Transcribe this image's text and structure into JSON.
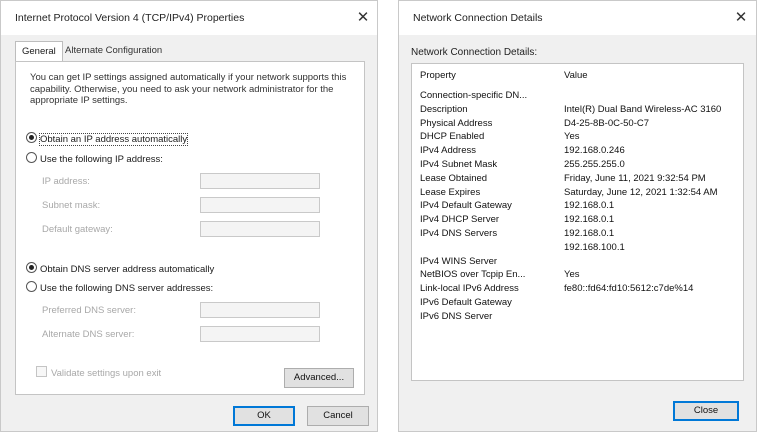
{
  "ipv4_dialog": {
    "title": "Internet Protocol Version 4 (TCP/IPv4) Properties",
    "close_glyph": "✕",
    "tabs": [
      {
        "label": "General",
        "active": true
      },
      {
        "label": "Alternate Configuration",
        "active": false
      }
    ],
    "description": "You can get IP settings assigned automatically if your network supports this capability. Otherwise, you need to ask your network administrator for the appropriate IP settings.",
    "ip_auto_label": "Obtain an IP address automatically",
    "ip_manual_label": "Use the following IP address:",
    "ip_address_label": "IP address:",
    "subnet_mask_label": "Subnet mask:",
    "default_gateway_label": "Default gateway:",
    "dns_auto_label": "Obtain DNS server address automatically",
    "dns_manual_label": "Use the following DNS server addresses:",
    "preferred_dns_label": "Preferred DNS server:",
    "alternate_dns_label": "Alternate DNS server:",
    "validate_label": "Validate settings upon exit",
    "advanced_button": "Advanced...",
    "ok_button": "OK",
    "cancel_button": "Cancel"
  },
  "details_dialog": {
    "title": "Network Connection Details",
    "close_glyph": "✕",
    "group_title": "Network Connection Details:",
    "col_property": "Property",
    "col_value": "Value",
    "rows": [
      {
        "property": "Connection-specific DN...",
        "value": ""
      },
      {
        "property": "Description",
        "value": "Intel(R) Dual Band Wireless-AC 3160"
      },
      {
        "property": "Physical Address",
        "value": "D4-25-8B-0C-50-C7"
      },
      {
        "property": "DHCP Enabled",
        "value": "Yes"
      },
      {
        "property": "IPv4 Address",
        "value": "192.168.0.246"
      },
      {
        "property": "IPv4 Subnet Mask",
        "value": "255.255.255.0"
      },
      {
        "property": "Lease Obtained",
        "value": "Friday, June 11, 2021 9:32:54 PM"
      },
      {
        "property": "Lease Expires",
        "value": "Saturday, June 12, 2021 1:32:54 AM"
      },
      {
        "property": "IPv4 Default Gateway",
        "value": "192.168.0.1"
      },
      {
        "property": "IPv4 DHCP Server",
        "value": "192.168.0.1"
      },
      {
        "property": "IPv4 DNS Servers",
        "value": "192.168.0.1"
      },
      {
        "property": "",
        "value": "192.168.100.1"
      },
      {
        "property": "IPv4 WINS Server",
        "value": ""
      },
      {
        "property": "NetBIOS over Tcpip En...",
        "value": "Yes"
      },
      {
        "property": "Link-local IPv6 Address",
        "value": "fe80::fd64:fd10:5612:c7de%14"
      },
      {
        "property": "IPv6 Default Gateway",
        "value": ""
      },
      {
        "property": "IPv6 DNS Server",
        "value": ""
      }
    ],
    "close_button": "Close"
  }
}
